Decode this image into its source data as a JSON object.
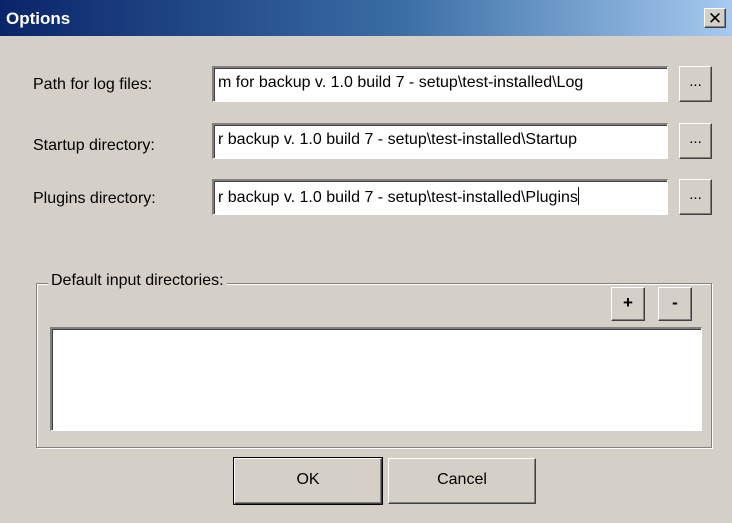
{
  "window": {
    "title": "Options",
    "close_glyph": "✕"
  },
  "fields": [
    {
      "label": "Path for log files:",
      "value": "m for backup v. 1.0 build 7 - setup\\test-installed\\Log",
      "browse_label": "..."
    },
    {
      "label": "Startup directory:",
      "value": "r backup v. 1.0 build 7 - setup\\test-installed\\Startup",
      "browse_label": "..."
    },
    {
      "label": "Plugins directory:",
      "value": "r backup v. 1.0 build 7 - setup\\test-installed\\Plugins",
      "browse_label": "..."
    }
  ],
  "input_directories": {
    "legend": "Default input directories:",
    "add_label": "+",
    "remove_label": "-",
    "items": []
  },
  "buttons": {
    "ok": "OK",
    "cancel": "Cancel"
  },
  "colors": {
    "face": "#d4d0c8",
    "title_start": "#0a246a",
    "title_end": "#a6caf0"
  },
  "icons": {
    "close": "close-icon"
  }
}
